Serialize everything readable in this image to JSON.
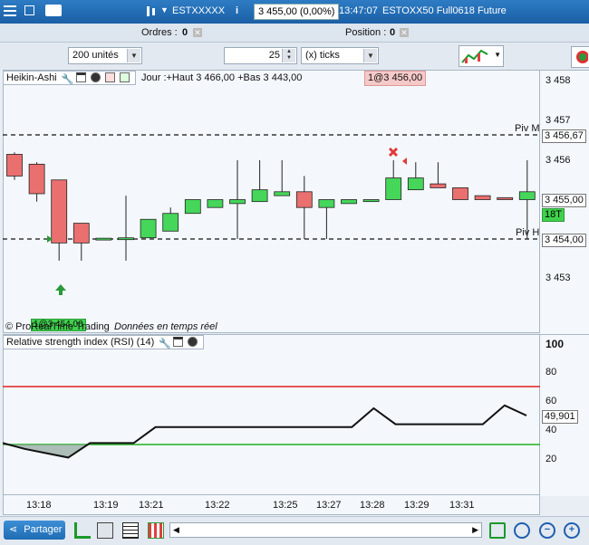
{
  "title_bar": {
    "instrument": "ESTXXXXX",
    "info_icon_label": "i",
    "price_change": "3 455,00 (0,00%)",
    "time": "13:47:07",
    "product": "ESTOXX50 Full0618 Future"
  },
  "orders_row": {
    "orders_label": "Ordres :",
    "orders_count": "0",
    "position_label": "Position :",
    "position_count": "0"
  },
  "toolbar": {
    "quantity_value": "200 unités",
    "ticks_value": "25",
    "ticks_unit": "(x) ticks"
  },
  "price_panel": {
    "indicator_name": "Heikin-Ashi",
    "ohlc_info": "Jour :+Haut 3 466,00 +Bas 3 443,00",
    "order_badge": "1@3 456,00",
    "lower_badge": "1@3 454,00",
    "footer_brand": "© ProRealTime Trading",
    "footer_status": "Données en temps réel",
    "pivot_m_label": "Piv M",
    "pivot_h_label": "Piv H",
    "pivot_m_value": "3 456,67",
    "current_price": "3 455,00",
    "timer": "18T",
    "pivot_h_value": "3 454,00",
    "y_ticks": [
      "3 458",
      "3 457",
      "3 456",
      "3 454",
      "3 453"
    ]
  },
  "rsi_panel": {
    "indicator_name": "Relative strength index (RSI) (14)",
    "current_value": "49,901",
    "y_ticks": [
      "100",
      "80",
      "60",
      "40",
      "20"
    ]
  },
  "x_axis": {
    "ticks": [
      "13:18",
      "13:19",
      "13:21",
      "13:22",
      "13:25",
      "13:27",
      "13:28",
      "13:29",
      "13:31"
    ]
  },
  "bottom_bar": {
    "share_label": "Partager"
  },
  "chart_data": [
    {
      "type": "candlestick",
      "title": "Heikin-Ashi",
      "price_unit": "index points",
      "ylim": [
        3452.3,
        3458.3
      ],
      "pivots": {
        "Piv M": 3456.67,
        "Piv H": 3454.0
      },
      "candles": [
        {
          "open": 3456.15,
          "high": 3456.2,
          "low": 3455.5,
          "close": 3455.6
        },
        {
          "open": 3455.9,
          "high": 3455.95,
          "low": 3454.95,
          "close": 3455.15
        },
        {
          "open": 3455.5,
          "high": 3455.5,
          "low": 3453.45,
          "close": 3453.9
        },
        {
          "open": 3454.4,
          "high": 3454.4,
          "low": 3453.45,
          "close": 3453.9
        },
        {
          "open": 3453.98,
          "high": 3454.02,
          "low": 3453.98,
          "close": 3454.02
        },
        {
          "open": 3454.0,
          "high": 3455.1,
          "low": 3453.45,
          "close": 3454.03
        },
        {
          "open": 3454.03,
          "high": 3454.5,
          "low": 3454.03,
          "close": 3454.5
        },
        {
          "open": 3454.2,
          "high": 3454.8,
          "low": 3454.2,
          "close": 3454.65
        },
        {
          "open": 3454.65,
          "high": 3455.0,
          "low": 3454.65,
          "close": 3455.0
        },
        {
          "open": 3454.8,
          "high": 3455.0,
          "low": 3454.8,
          "close": 3455.0
        },
        {
          "open": 3454.9,
          "high": 3456.0,
          "low": 3454.0,
          "close": 3455.0
        },
        {
          "open": 3454.95,
          "high": 3456.0,
          "low": 3454.95,
          "close": 3455.25
        },
        {
          "open": 3455.1,
          "high": 3456.0,
          "low": 3455.1,
          "close": 3455.2
        },
        {
          "open": 3455.2,
          "high": 3455.6,
          "low": 3454.0,
          "close": 3454.8
        },
        {
          "open": 3454.8,
          "high": 3455.0,
          "low": 3454.0,
          "close": 3455.0
        },
        {
          "open": 3454.9,
          "high": 3455.0,
          "low": 3454.9,
          "close": 3455.0
        },
        {
          "open": 3454.95,
          "high": 3455.0,
          "low": 3454.95,
          "close": 3455.0
        },
        {
          "open": 3455.0,
          "high": 3456.0,
          "low": 3455.0,
          "close": 3455.55
        },
        {
          "open": 3455.25,
          "high": 3455.95,
          "low": 3455.25,
          "close": 3455.55
        },
        {
          "open": 3455.4,
          "high": 3455.95,
          "low": 3455.3,
          "close": 3455.3
        },
        {
          "open": 3455.3,
          "high": 3455.3,
          "low": 3455.0,
          "close": 3455.0
        },
        {
          "open": 3455.1,
          "high": 3455.1,
          "low": 3455.0,
          "close": 3455.0
        },
        {
          "open": 3455.05,
          "high": 3455.05,
          "low": 3455.0,
          "close": 3455.0
        },
        {
          "open": 3455.0,
          "high": 3456.0,
          "low": 3454.0,
          "close": 3455.2
        }
      ]
    },
    {
      "type": "line",
      "title": "Relative strength index (RSI) (14)",
      "ylim": [
        0,
        110
      ],
      "levels": {
        "overbought": 70,
        "oversold": 30
      },
      "values": [
        31,
        27,
        24,
        21,
        31,
        31,
        31,
        42,
        42,
        42,
        42,
        42,
        42,
        42,
        42,
        42,
        42,
        55,
        44,
        44,
        44,
        44,
        44,
        57,
        50
      ]
    }
  ]
}
